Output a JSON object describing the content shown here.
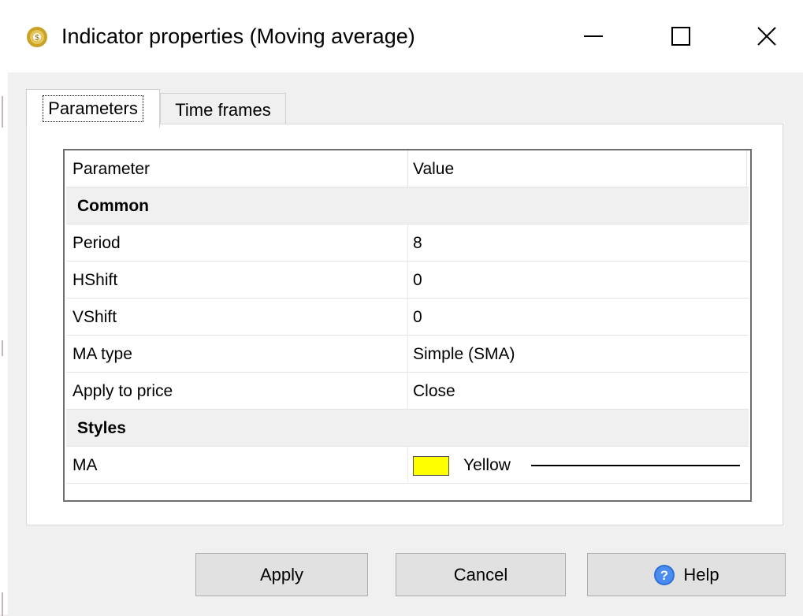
{
  "window": {
    "title": "Indicator properties (Moving average)",
    "icon": "gear-coin-icon",
    "controls": [
      "minimize-icon",
      "maximize-icon",
      "close-icon"
    ]
  },
  "tabs": [
    {
      "label": "Parameters",
      "active": true
    },
    {
      "label": "Time frames",
      "active": false
    }
  ],
  "grid": {
    "headers": {
      "parameter": "Parameter",
      "value": "Value"
    },
    "rows": [
      {
        "type": "category",
        "name": "Common"
      },
      {
        "type": "param",
        "name": "Period",
        "value": "8"
      },
      {
        "type": "param",
        "name": "HShift",
        "value": "0"
      },
      {
        "type": "param",
        "name": "VShift",
        "value": "0"
      },
      {
        "type": "param",
        "name": "MA type",
        "value": "Simple (SMA)"
      },
      {
        "type": "param",
        "name": "Apply to price",
        "value": "Close"
      },
      {
        "type": "category",
        "name": "Styles"
      },
      {
        "type": "style",
        "name": "MA",
        "color_name": "Yellow",
        "color": "#ffff00",
        "line": "solid"
      }
    ]
  },
  "buttons": {
    "apply": "Apply",
    "cancel": "Cancel",
    "help": "Help"
  },
  "colors": {
    "background": "#f0f0f0",
    "grid_border": "#6e6e6e",
    "category_bg": "#f0f0f0",
    "help_icon": "#2f6fd6"
  }
}
